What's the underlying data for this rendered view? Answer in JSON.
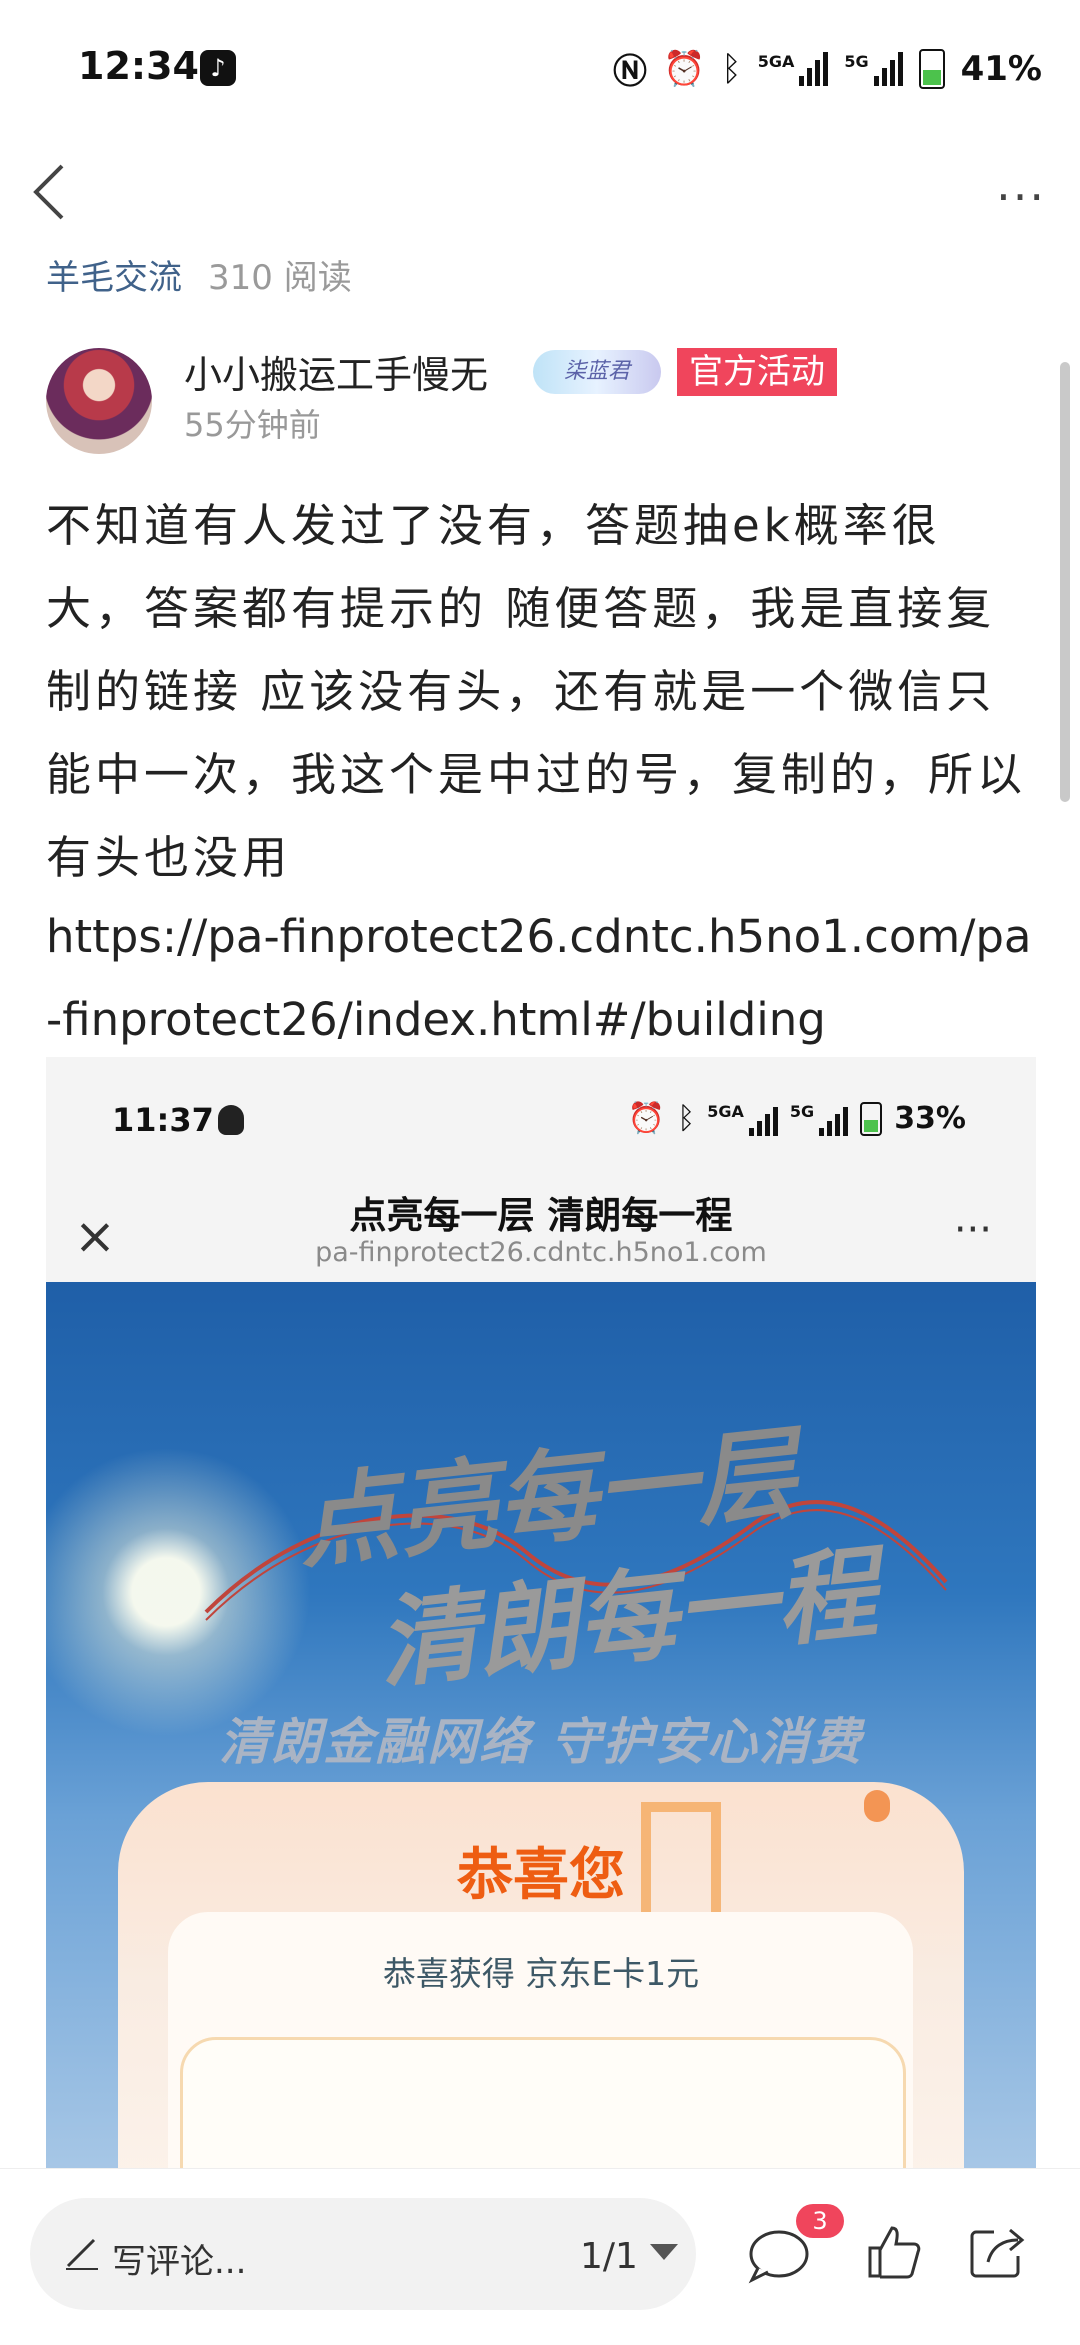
{
  "status_bar": {
    "time": "12:34",
    "battery_percent": "41%",
    "network_1": "5GA",
    "network_2": "5G",
    "icons": [
      "tiktok-icon",
      "nfc-icon",
      "alarm-icon",
      "bluetooth-icon",
      "signal-icon",
      "battery-icon"
    ]
  },
  "nav": {
    "back_icon": "chevron-left-icon",
    "more_label": "···"
  },
  "post_meta": {
    "channel": "羊毛交流",
    "reads": "310 阅读"
  },
  "author": {
    "name": "小小搬运工手慢无",
    "badge_text": "柒蓝君",
    "tag": "官方活动",
    "time": "55分钟前"
  },
  "post": {
    "body": "不知道有人发过了没有，答题抽ek概率很大，答案都有提示的 随便答题，我是直接复制的链接 应该没有头，还有就是一个微信只能中一次，我这个是中过的号，复制的，所以有头也没用",
    "link": "https://pa-finprotect26.cdntc.h5no1.com/pa-finprotect26/index.html#/building"
  },
  "embedded_screenshot": {
    "time": "11:37",
    "battery_percent": "33%",
    "network_1": "5GA",
    "network_2": "5G",
    "title": "点亮每一层 清朗每一程",
    "url": "pa-finprotect26.cdntc.h5no1.com",
    "close_label": "×",
    "more_label": "···",
    "hero_line1": "点亮每一层",
    "hero_line2": "清朗每一程",
    "hero_subtitle": "清朗金融网络 守护安心消费",
    "card_title": "恭喜您",
    "card_message": "恭喜获得 京东E卡1元"
  },
  "bottom_bar": {
    "comment_placeholder": "写评论...",
    "page_indicator": "1/1",
    "comment_count": "3"
  },
  "colors": {
    "accent_red": "#f0455c",
    "link_blue": "#40628a",
    "orange": "#ee5d12"
  }
}
